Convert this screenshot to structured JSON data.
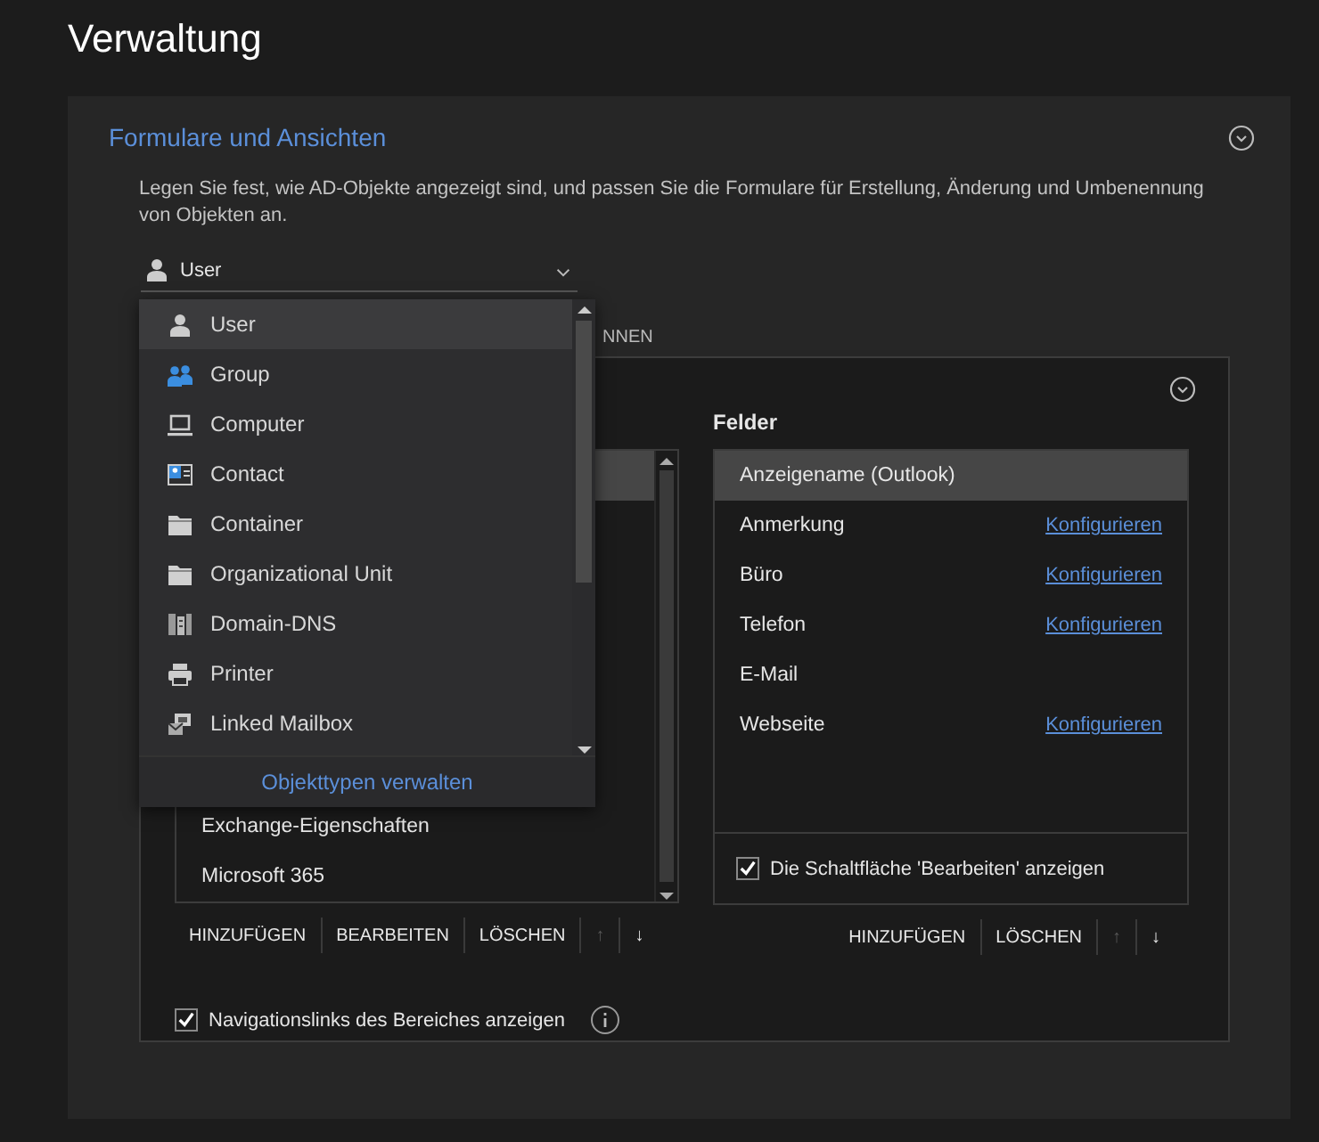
{
  "page_title": "Verwaltung",
  "section": {
    "title": "Formulare und Ansichten",
    "expanded": true,
    "description": "Legen Sie fest, wie AD-Objekte angezeigt sind, und passen Sie die Formulare für Erstellung, Änderung und Umbenennung von Objekten an.",
    "object_type_select": {
      "value": "User",
      "kind": "user"
    },
    "tab_fragment": "NNEN",
    "form_panel": {
      "categories": [
        {
          "selected": true
        },
        {
          "label": "Exchange-Eigenschaften",
          "selected": false
        },
        {
          "label": "Microsoft 365",
          "selected": false
        }
      ],
      "category_buttons": [
        {
          "label": "HINZUFÜGEN",
          "disabled": false
        },
        {
          "label": "BEARBEITEN",
          "disabled": false
        },
        {
          "label": "LÖSCHEN",
          "disabled": false
        },
        {
          "label": "↑",
          "disabled": true
        },
        {
          "label": "↓",
          "disabled": false
        }
      ],
      "fields_title": "Felder",
      "fields": [
        {
          "label": "Anzeigename (Outlook)",
          "selected": true
        },
        {
          "label": "Anmerkung",
          "selected": false,
          "link": "Konfigurieren"
        },
        {
          "label": "Büro",
          "selected": false,
          "link": "Konfigurieren"
        },
        {
          "label": "Telefon",
          "selected": false,
          "link": "Konfigurieren"
        },
        {
          "label": "E-Mail",
          "selected": false
        },
        {
          "label": "Webseite",
          "selected": false,
          "link": "Konfigurieren"
        }
      ],
      "show_edit_button": {
        "label": "Die Schaltfläche 'Bearbeiten' anzeigen",
        "checked": true
      },
      "field_buttons": [
        {
          "label": "HINZUFÜGEN",
          "disabled": false
        },
        {
          "label": "LÖSCHEN",
          "disabled": false
        },
        {
          "label": "↑",
          "disabled": true
        },
        {
          "label": "↓",
          "disabled": false
        }
      ]
    },
    "show_nav_links": {
      "label": "Navigationslinks des Bereiches anzeigen",
      "checked": true
    },
    "dropdown": {
      "items": [
        {
          "label": "User",
          "kind": "user",
          "selected": true
        },
        {
          "label": "Group",
          "kind": "group",
          "selected": false
        },
        {
          "label": "Computer",
          "kind": "computer",
          "selected": false
        },
        {
          "label": "Contact",
          "kind": "contact",
          "selected": false
        },
        {
          "label": "Container",
          "kind": "folder",
          "selected": false
        },
        {
          "label": "Organizational Unit",
          "kind": "folder",
          "selected": false
        },
        {
          "label": "Domain-DNS",
          "kind": "domain",
          "selected": false
        },
        {
          "label": "Printer",
          "kind": "printer",
          "selected": false
        },
        {
          "label": "Linked Mailbox",
          "kind": "mailbox",
          "selected": false
        }
      ],
      "footer_link": "Objekttypen verwalten"
    }
  }
}
